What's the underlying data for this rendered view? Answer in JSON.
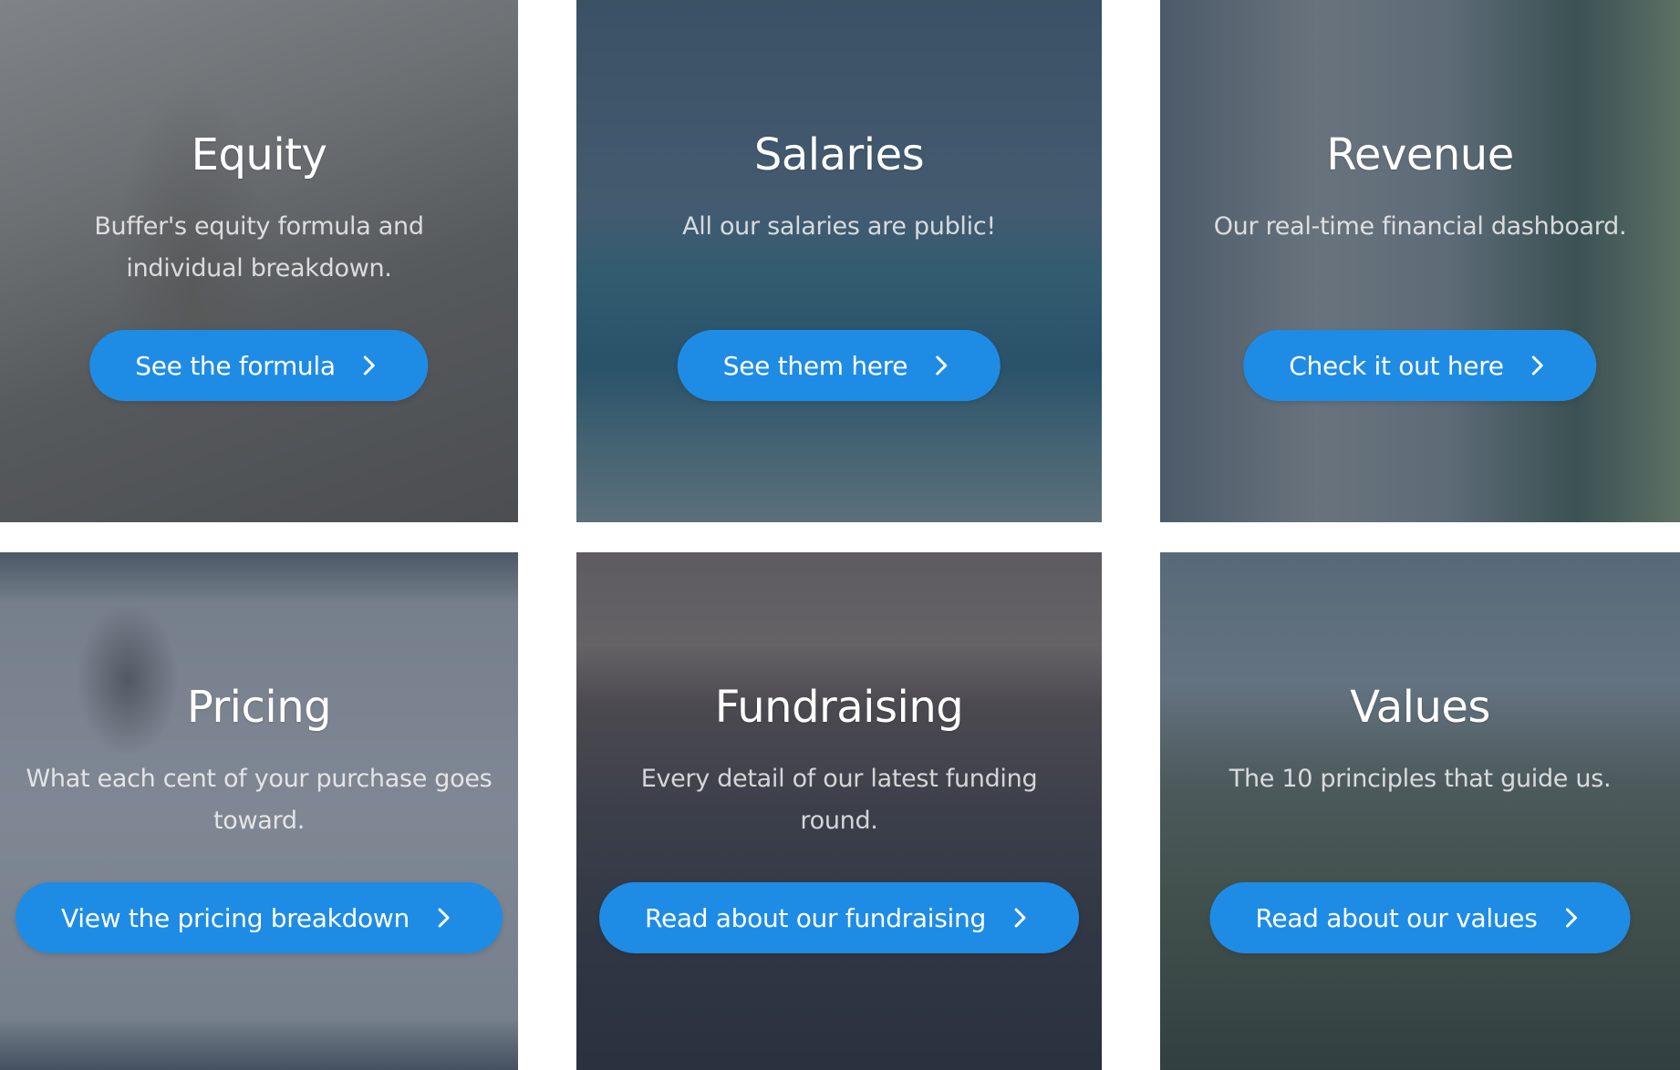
{
  "cards": [
    {
      "title": "Equity",
      "description": "Buffer's equity formula and individual breakdown.",
      "button": "See the formula",
      "icon": "chevron-right-icon"
    },
    {
      "title": "Salaries",
      "description": "All our salaries are public!",
      "button": "See them here",
      "icon": "chevron-right-icon"
    },
    {
      "title": "Revenue",
      "description": "Our real-time financial dashboard.",
      "button": "Check it out here",
      "icon": "chevron-right-icon"
    },
    {
      "title": "Pricing",
      "description": "What each cent of your purchase goes toward.",
      "button": "View the pricing breakdown",
      "icon": "chevron-right-icon"
    },
    {
      "title": "Fundraising",
      "description": "Every detail of our latest funding round.",
      "button": "Read about our fundraising",
      "icon": "chevron-right-icon"
    },
    {
      "title": "Values",
      "description": "The 10 principles that guide us.",
      "button": "Read about our values",
      "icon": "chevron-right-icon"
    }
  ],
  "colors": {
    "button": "#1e8ce5",
    "overlay": "#263448",
    "text": "#ffffff"
  }
}
